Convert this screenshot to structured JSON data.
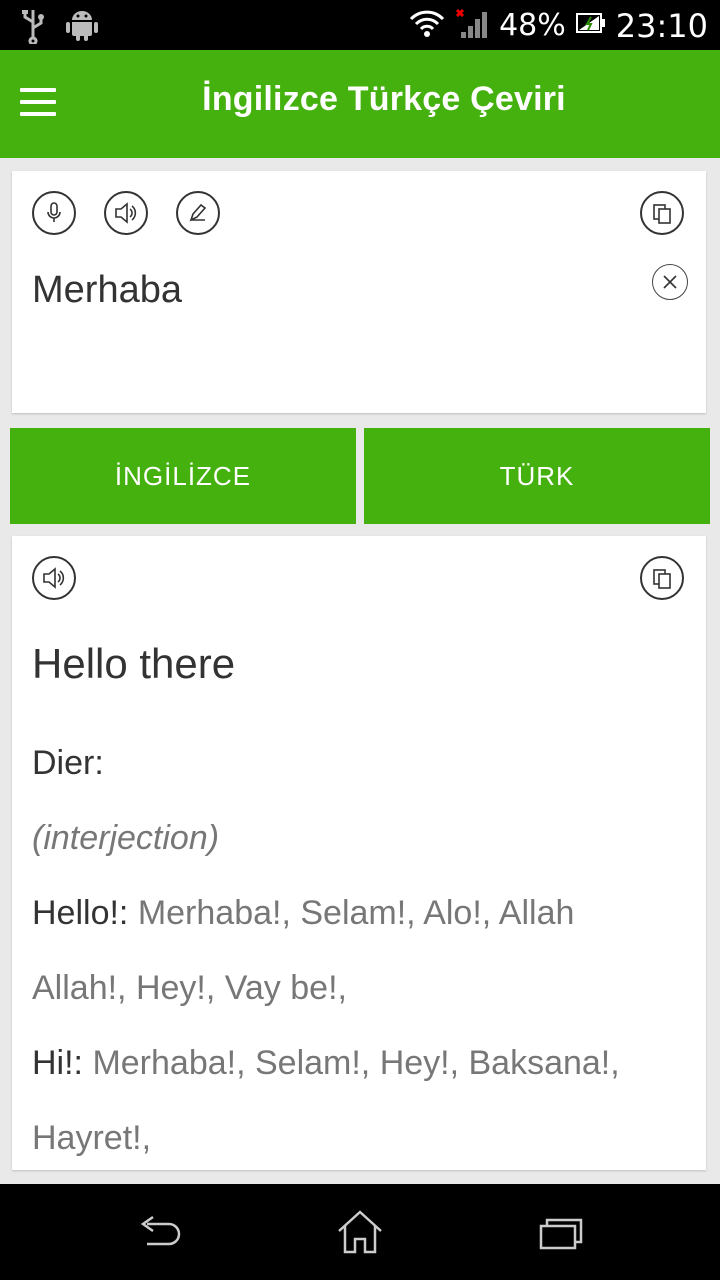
{
  "status_bar": {
    "battery": "48%",
    "time": "23:10",
    "icons": [
      "usb-icon",
      "android-icon",
      "wifi-icon",
      "signal-icon",
      "battery-icon"
    ]
  },
  "app_bar": {
    "title": "İngilizce Türkçe Çeviri",
    "color": "#45b10e"
  },
  "input_card": {
    "text": "Merhaba",
    "icons": [
      "microphone-icon",
      "speaker-icon",
      "pencil-icon",
      "copy-icon",
      "clear-icon"
    ]
  },
  "languages": {
    "source": "İNGİLİZCE",
    "target": "TÜRK"
  },
  "output_card": {
    "translation": "Hello there",
    "section_label": "Dier:",
    "part_of_speech": "(interjection)",
    "entries": [
      {
        "term": "Hello!:",
        "meanings": "Merhaba!, Selam!, Alo!, Allah",
        "continuation": "Allah!, Hey!, Vay be!,"
      },
      {
        "term": "Hi!:",
        "meanings": "Merhaba!, Selam!, Hey!, Baksana!,",
        "continuation": "Hayret!,"
      }
    ]
  }
}
